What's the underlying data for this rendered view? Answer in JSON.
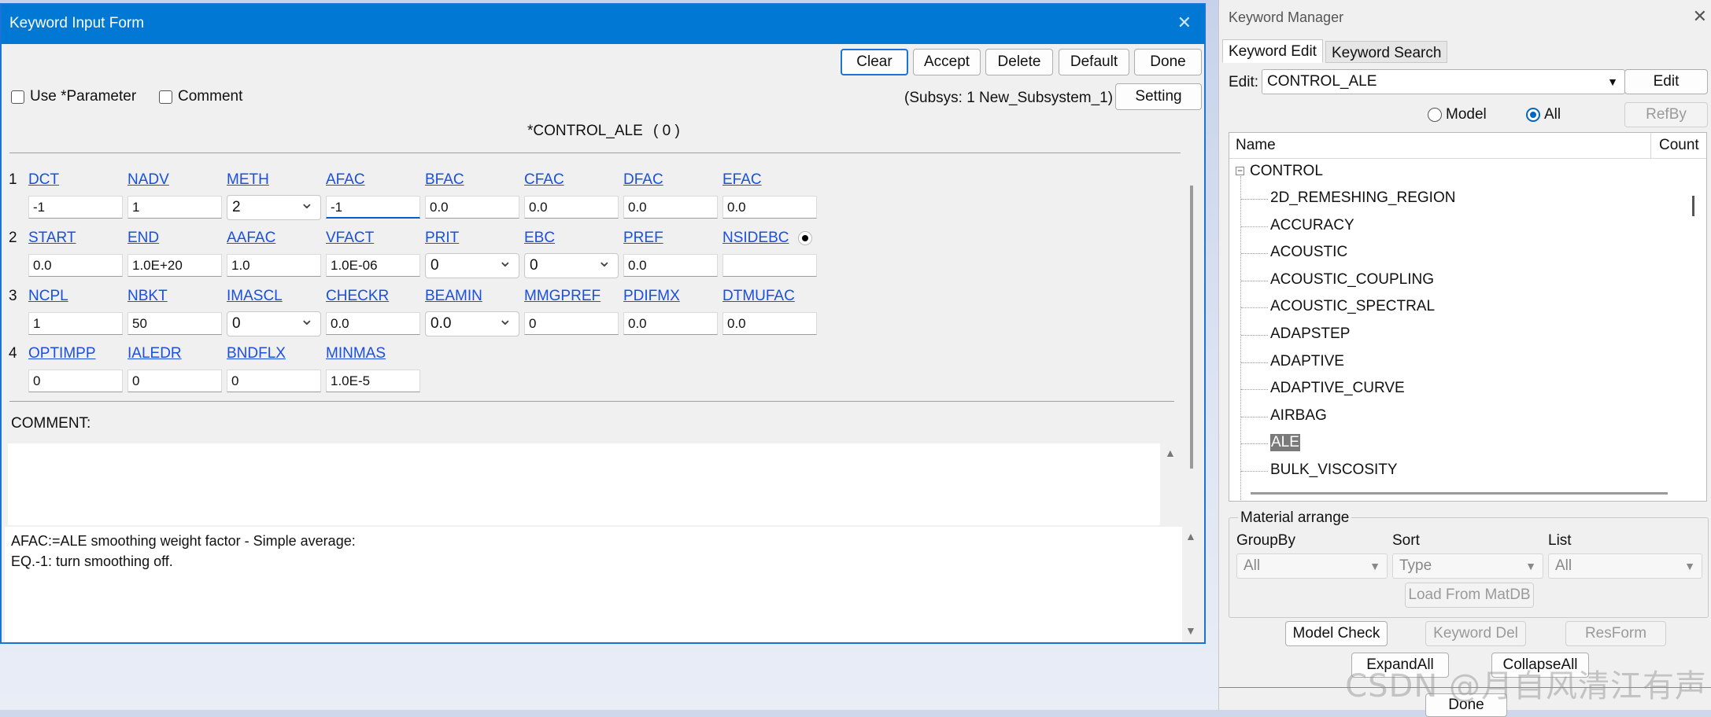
{
  "form": {
    "title": "Keyword Input Form",
    "close_glyph": "✕",
    "buttons": [
      "Clear",
      "Accept",
      "Delete",
      "Default",
      "Done"
    ],
    "use_parameter_label": "Use *Parameter",
    "comment_check_label": "Comment",
    "subsys_label": "(Subsys: 1 New_Subsystem_1)",
    "setting_label": "Setting",
    "keyword_header": "*CONTROL_ALE",
    "keyword_count": "( 0 )",
    "rows": [
      {
        "num": "1",
        "fields": [
          {
            "label": "DCT",
            "value": "-1",
            "type": "text"
          },
          {
            "label": "NADV",
            "value": "1",
            "type": "text"
          },
          {
            "label": "METH",
            "value": "2",
            "type": "select"
          },
          {
            "label": "AFAC",
            "value": "-1",
            "type": "text",
            "active": true
          },
          {
            "label": "BFAC",
            "value": "0.0",
            "type": "text"
          },
          {
            "label": "CFAC",
            "value": "0.0",
            "type": "text"
          },
          {
            "label": "DFAC",
            "value": "0.0",
            "type": "text"
          },
          {
            "label": "EFAC",
            "value": "0.0",
            "type": "text"
          }
        ]
      },
      {
        "num": "2",
        "fields": [
          {
            "label": "START",
            "value": "0.0",
            "type": "text"
          },
          {
            "label": "END",
            "value": "1.0E+20",
            "type": "text"
          },
          {
            "label": "AAFAC",
            "value": "1.0",
            "type": "text"
          },
          {
            "label": "VFACT",
            "value": "1.0E-06",
            "type": "text"
          },
          {
            "label": "PRIT",
            "value": "0",
            "type": "select"
          },
          {
            "label": "EBC",
            "value": "0",
            "type": "select"
          },
          {
            "label": "PREF",
            "value": "0.0",
            "type": "text"
          },
          {
            "label": "NSIDEBC",
            "value": "",
            "type": "text",
            "dot": true
          }
        ]
      },
      {
        "num": "3",
        "fields": [
          {
            "label": "NCPL",
            "value": "1",
            "type": "text"
          },
          {
            "label": "NBKT",
            "value": "50",
            "type": "text"
          },
          {
            "label": "IMASCL",
            "value": "0",
            "type": "select"
          },
          {
            "label": "CHECKR",
            "value": "0.0",
            "type": "text"
          },
          {
            "label": "BEAMIN",
            "value": "0.0",
            "type": "select"
          },
          {
            "label": "MMGPREF",
            "value": "0",
            "type": "text"
          },
          {
            "label": "PDIFMX",
            "value": "0.0",
            "type": "text"
          },
          {
            "label": "DTMUFAC",
            "value": "0.0",
            "type": "text"
          }
        ]
      },
      {
        "num": "4",
        "fields": [
          {
            "label": "OPTIMPP",
            "value": "0",
            "type": "text"
          },
          {
            "label": "IALEDR",
            "value": "0",
            "type": "text"
          },
          {
            "label": "BNDFLX",
            "value": "0",
            "type": "text"
          },
          {
            "label": "MINMAS",
            "value": "1.0E-5",
            "type": "text"
          }
        ]
      }
    ],
    "comment_label": "COMMENT:",
    "help_lines": [
      "AFAC:=ALE smoothing weight factor - Simple average:",
      "EQ.-1: turn smoothing off."
    ]
  },
  "manager": {
    "title": "Keyword Manager",
    "close_glyph": "✕",
    "tabs": [
      "Keyword Edit",
      "Keyword Search"
    ],
    "edit_label": "Edit:",
    "edit_value": "CONTROL_ALE",
    "edit_button": "Edit",
    "radio_model": "Model",
    "radio_all": "All",
    "refby_button": "RefBy",
    "col_name": "Name",
    "col_count": "Count",
    "tree_root": "CONTROL",
    "tree_items": [
      "2D_REMESHING_REGION",
      "ACCURACY",
      "ACOUSTIC",
      "ACOUSTIC_COUPLING",
      "ACOUSTIC_SPECTRAL",
      "ADAPSTEP",
      "ADAPTIVE",
      "ADAPTIVE_CURVE",
      "AIRBAG",
      "ALE",
      "BULK_VISCOSITY"
    ],
    "selected_item": "ALE",
    "material_arrange": "Material arrange",
    "groupby_label": "GroupBy",
    "sort_label": "Sort",
    "list_label": "List",
    "groupby_value": "All",
    "sort_value": "Type",
    "list_value": "All",
    "load_matdb": "Load From MatDB",
    "model_check": "Model Check",
    "keyword_del": "Keyword Del",
    "resform": "ResForm",
    "expand_all": "ExpandAll",
    "collapse_all": "CollapseAll",
    "done": "Done",
    "watermark": "CSDN @月自风清江有声"
  }
}
